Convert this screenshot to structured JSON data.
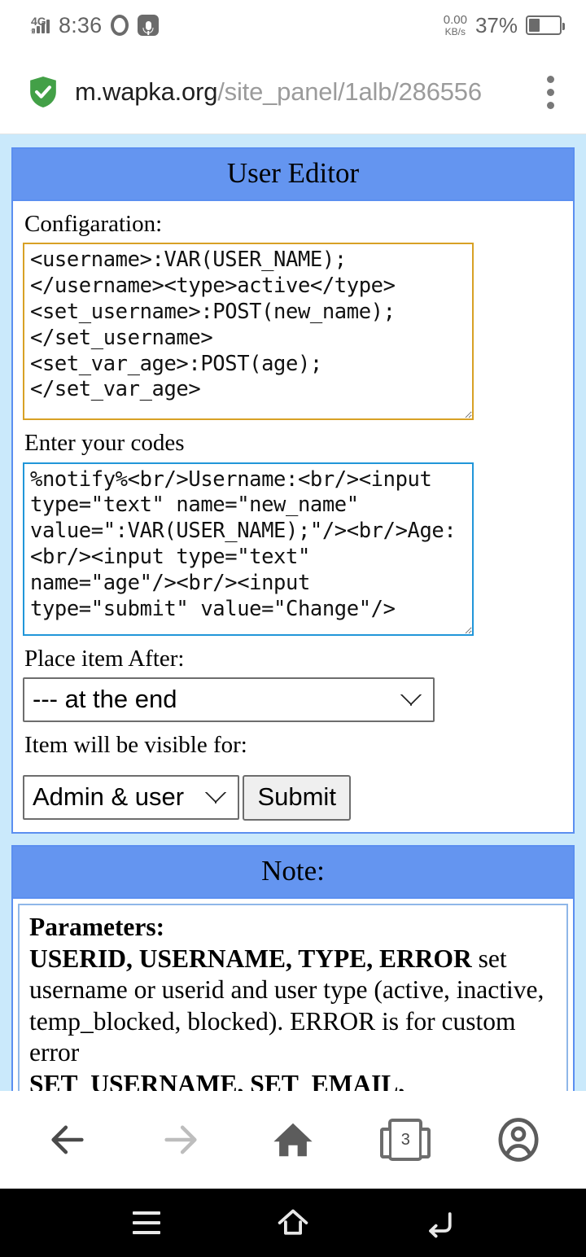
{
  "status_bar": {
    "network_label": "4G",
    "clock": "8:36",
    "browser_icon": "opera-logo-icon",
    "mic_icon": "microphone-icon",
    "data_rate": "0.00",
    "data_unit": "KB/s",
    "battery_percent": "37%",
    "battery_level": 37
  },
  "browser": {
    "security_icon": "green-shield-check-icon",
    "url_host": "m.wapka.org",
    "url_path": "/site_panel/1alb/286556",
    "menu_icon": "kebab-menu-icon",
    "bottom_nav": {
      "back_label": "back-arrow-icon",
      "forward_label": "forward-arrow-icon",
      "home_label": "home-icon",
      "tabs_count": "3",
      "profile_label": "account-icon"
    }
  },
  "page": {
    "panels": [
      {
        "title": "User Editor",
        "fields": {
          "configuration_label": "Configaration:",
          "configuration_value": "<username>:VAR(USER_NAME);\n</username><type>active</type>\n<set_username>:POST(new_name);\n</set_username>\n<set_var_age>:POST(age);\n</set_var_age>",
          "codes_label": "Enter your codes",
          "codes_value": "%notify%<br/>Username:<br/><input type=\"text\" name=\"new_name\" value=\":VAR(USER_NAME);\"/><br/>Age:<br/><input type=\"text\" name=\"age\"/><br/><input type=\"submit\" value=\"Change\"/>",
          "place_label": "Place item After:",
          "place_value": "--- at the end",
          "place_options": [
            "--- at the end"
          ],
          "visible_label": "Item will be visible for:",
          "visible_value": "Admin & user",
          "visible_options": [
            "Admin & user"
          ],
          "submit_label": "Submit"
        }
      },
      {
        "title": "Note:",
        "note": {
          "heading": "Parameters:",
          "line1_bold": "USERID, USERNAME, TYPE, ERROR",
          "line1_rest": " set username or userid and user type (active, inactive, temp_blocked, blocked). ERROR is for custom error",
          "line2_bold": "SET_USERNAME, SET_EMAIL, SET_PASSWORD, SET_TYPE,"
        }
      }
    ]
  },
  "system_nav": {
    "recents_icon": "menu-recents-icon",
    "home_icon": "home-outline-icon",
    "back_icon": "back-curved-arrow-icon"
  },
  "colors": {
    "page_background": "#cae9fb",
    "panel_header": "#6495f0",
    "panel_border": "#5b8ff0",
    "textarea_focus_border": "#d8a125",
    "textarea_border": "#2196d9",
    "shield_green": "#43a047",
    "status_gray": "#6b6b6b"
  }
}
